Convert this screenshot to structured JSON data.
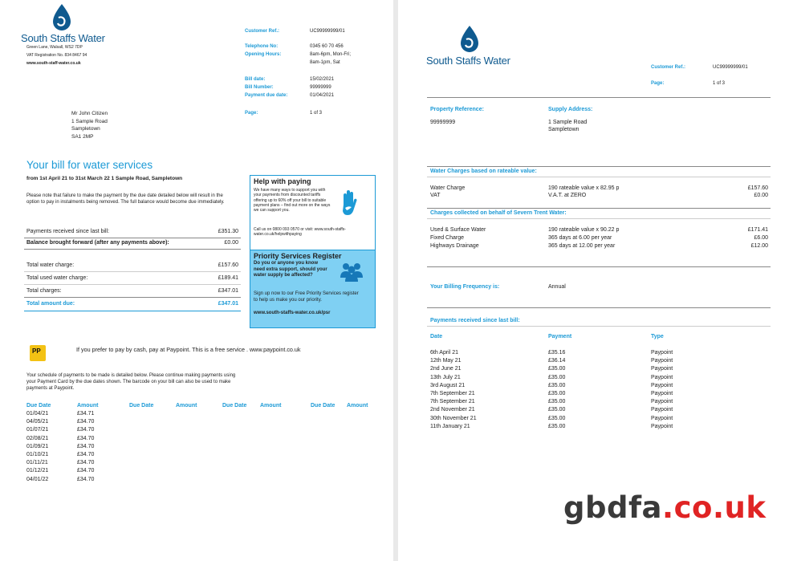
{
  "brand": {
    "name": "South Staffs Water",
    "address": "Green Lane, Walsall, WS2 7DP",
    "vat": "VAT Registration No. 834 8467 94",
    "web": "www.south-staff-water.co.uk",
    "color": "#1c9ad6",
    "logo_color": "#0f5a8f"
  },
  "page1": {
    "meta": {
      "customer_ref_label": "Customer Ref.:",
      "customer_ref": "UC99999999/01",
      "telephone_label": "Telephone No:",
      "telephone": "0345 60 70 456",
      "hours_label": "Opening Hours:",
      "hours1": "8am-6pm, Mon-Fri;",
      "hours2": "8am-1pm, Sat",
      "bill_date_label": "Bill date:",
      "bill_date": "15/02/2021",
      "bill_number_label": "Bill Number:",
      "bill_number": "99999999",
      "due_label": "Payment due date:",
      "due": "01/04/2021",
      "page_label": "Page:",
      "page": "1 of 3"
    },
    "recipient": [
      "Mr John Citizen",
      "1 Sample Road",
      "Sampletown",
      "SA1 2MP"
    ],
    "heading": "Your bill for water services",
    "period": "from 1st April 21 to 31st March 22 1 Sample Road, Sampletown",
    "notice": "Please note that failure to make the payment by the due date detailed below will result in the option to pay in instalments being removed. The full balance would become due immediately.",
    "summary": {
      "received_label": "Payments received since last bill:",
      "received": "£351.30",
      "balance_label": "Balance brought forward (after any payments above):",
      "balance": "£0.00",
      "water_label": "Total water charge:",
      "water": "£157.60",
      "used_label": "Total used water charge:",
      "used": "£189.41",
      "charges_label": "Total charges:",
      "charges": "£347.01",
      "due_label": "Total amount due:",
      "due": "£347.01"
    },
    "help": {
      "title": "Help with paying",
      "body": "We have many ways to support you with your payments from discounted tariffs offering up to 60% off your bill to suitable payment plans – find out more on the ways we can support you.",
      "contact": "Call us on 0800 093 0570 or visit: www.south-staffs-water.co.uk/helpwithpaying"
    },
    "psr": {
      "title": "Priority Services Register",
      "question": "Do you or anyone you know need extra support, should your water supply be affected?",
      "body": "Sign up now to our Free Priority Services register to help us make you our priority.",
      "link": "www.south-staffs-water.co.uk/psr"
    },
    "paypoint_logo": "PP",
    "paypoint_text": "If you prefer to pay by cash, pay at Paypoint. This is a free service . www.paypoint.co.uk",
    "schedule_intro": "Your schedule of payments to be made is detailed below. Please continue making payments using your Payment Card by the due dates shown. The barcode on your bill can also be used to make payments at Paypoint.",
    "schedule_headers": [
      "Due Date",
      "Amount",
      "Due Date",
      "Amount",
      "Due Date",
      "Amount",
      "Due Date",
      "Amount"
    ],
    "schedule_dates": [
      "01/04/21",
      "04/05/21",
      "01/07/21",
      "02/08/21",
      "01/09/21",
      "01/10/21",
      "01/11/21",
      "01/12/21",
      "04/01/22"
    ],
    "schedule_amounts": [
      "£34.71",
      "£34.70",
      "£34.70",
      "£34.70",
      "£34.70",
      "£34.70",
      "£34.70",
      "£34.70",
      "£34.70"
    ]
  },
  "page2": {
    "customer_ref_label": "Customer Ref.:",
    "customer_ref": "UC99999999/01",
    "page_label": "Page:",
    "page": "1 of 3",
    "property_ref_label": "Property Reference:",
    "property_ref": "99999999",
    "supply_label": "Supply Address:",
    "supply1": "1 Sample Road",
    "supply2": "Sampletown",
    "charges_title": "Water Charges based on rateable value:",
    "charges": [
      {
        "label": "Water Charge",
        "desc": "190 rateable value x 82.95 p",
        "amount": "£157.60"
      },
      {
        "label": "VAT",
        "desc": "V.A.T. at ZERO",
        "amount": "£0.00"
      }
    ],
    "severn_title": "Charges collected on behalf of Severn Trent Water:",
    "severn": [
      {
        "label": "Used & Surface Water",
        "desc": "190 rateable value x 90.22 p",
        "amount": "£171.41"
      },
      {
        "label": "Fixed Charge",
        "desc": "365 days at 6.00 per year",
        "amount": "£6.00"
      },
      {
        "label": "Highways Drainage",
        "desc": "365 days at 12.00 per year",
        "amount": "£12.00"
      }
    ],
    "frequency_label": "Your Billing Frequency is:",
    "frequency": "Annual",
    "payments_title": "Payments received since last bill:",
    "payments_headers": {
      "date": "Date",
      "payment": "Payment",
      "type": "Type"
    },
    "payments": [
      {
        "date": "6th April 21",
        "amount": "£35.16",
        "type": "Paypoint"
      },
      {
        "date": "12th May 21",
        "amount": "£36.14",
        "type": "Paypoint"
      },
      {
        "date": "2nd June 21",
        "amount": "£35.00",
        "type": "Paypoint"
      },
      {
        "date": "13th July 21",
        "amount": "£35.00",
        "type": "Paypoint"
      },
      {
        "date": "3rd August 21",
        "amount": "£35.00",
        "type": "Paypoint"
      },
      {
        "date": "7th September 21",
        "amount": "£35.00",
        "type": "Paypoint"
      },
      {
        "date": "7th September 21",
        "amount": "£35.00",
        "type": "Paypoint"
      },
      {
        "date": "2nd November 21",
        "amount": "£35.00",
        "type": "Paypoint"
      },
      {
        "date": "30th November 21",
        "amount": "£35.00",
        "type": "Paypoint"
      },
      {
        "date": "11th January 21",
        "amount": "£35.00",
        "type": "Paypoint"
      }
    ]
  },
  "watermark": {
    "part1": "gbdfa",
    "part2": ".co.uk",
    "color1": "#3a3a3a",
    "color2": "#e02424"
  }
}
